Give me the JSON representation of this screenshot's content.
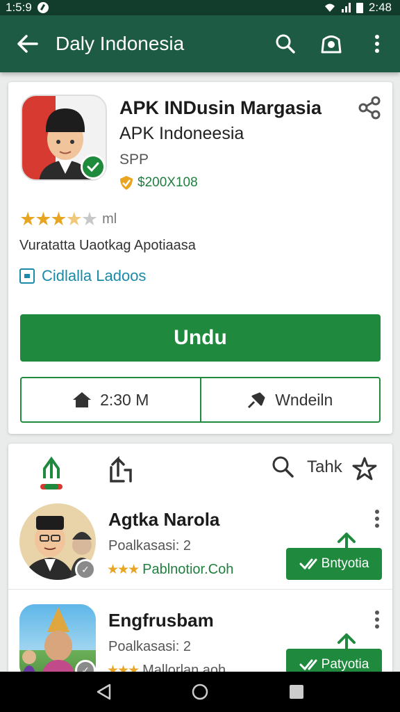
{
  "status_bar": {
    "time": "1:5:9",
    "clock": "2:48"
  },
  "app_bar": {
    "title": "Daly Indonesia"
  },
  "app": {
    "title": "APK INDusin Margasia",
    "subtitle": "APK Indoneesia",
    "price": "SPP",
    "size": "$200X108",
    "rating": 3.5,
    "rating_label": "ml",
    "description": "Vuratatta Uaotkag Apotiaasa",
    "link_label": "Cidlalla Ladoos",
    "install_label": "Undu",
    "home_label": "2:30 M",
    "wishlist_label": "Wndeiln"
  },
  "list_toolbar": {
    "label": "Tahk"
  },
  "list": [
    {
      "title": "Agtka Narola",
      "subtitle": "Poalkasasi: 2",
      "meta": "Pablnotior.Coh",
      "button": "Bntyotia"
    },
    {
      "title": "Engfrusbam",
      "subtitle": "Poalkasasi: 2",
      "meta": "Mallorlan.aoh",
      "button": "Patyotia"
    }
  ],
  "colors": {
    "primary": "#1e5b44",
    "accent": "#1f8a3e",
    "status_bar": "#123c2c"
  }
}
